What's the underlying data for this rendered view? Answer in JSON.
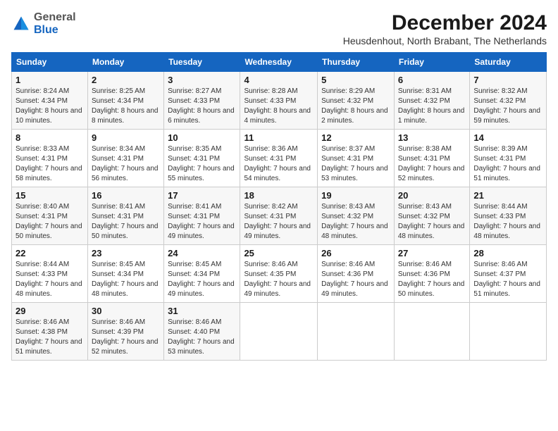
{
  "header": {
    "logo_general": "General",
    "logo_blue": "Blue",
    "title": "December 2024",
    "subtitle": "Heusdenhout, North Brabant, The Netherlands"
  },
  "calendar": {
    "days": [
      "Sunday",
      "Monday",
      "Tuesday",
      "Wednesday",
      "Thursday",
      "Friday",
      "Saturday"
    ],
    "weeks": [
      [
        {
          "day": "1",
          "sunrise": "Sunrise: 8:24 AM",
          "sunset": "Sunset: 4:34 PM",
          "daylight": "Daylight: 8 hours and 10 minutes."
        },
        {
          "day": "2",
          "sunrise": "Sunrise: 8:25 AM",
          "sunset": "Sunset: 4:34 PM",
          "daylight": "Daylight: 8 hours and 8 minutes."
        },
        {
          "day": "3",
          "sunrise": "Sunrise: 8:27 AM",
          "sunset": "Sunset: 4:33 PM",
          "daylight": "Daylight: 8 hours and 6 minutes."
        },
        {
          "day": "4",
          "sunrise": "Sunrise: 8:28 AM",
          "sunset": "Sunset: 4:33 PM",
          "daylight": "Daylight: 8 hours and 4 minutes."
        },
        {
          "day": "5",
          "sunrise": "Sunrise: 8:29 AM",
          "sunset": "Sunset: 4:32 PM",
          "daylight": "Daylight: 8 hours and 2 minutes."
        },
        {
          "day": "6",
          "sunrise": "Sunrise: 8:31 AM",
          "sunset": "Sunset: 4:32 PM",
          "daylight": "Daylight: 8 hours and 1 minute."
        },
        {
          "day": "7",
          "sunrise": "Sunrise: 8:32 AM",
          "sunset": "Sunset: 4:32 PM",
          "daylight": "Daylight: 7 hours and 59 minutes."
        }
      ],
      [
        {
          "day": "8",
          "sunrise": "Sunrise: 8:33 AM",
          "sunset": "Sunset: 4:31 PM",
          "daylight": "Daylight: 7 hours and 58 minutes."
        },
        {
          "day": "9",
          "sunrise": "Sunrise: 8:34 AM",
          "sunset": "Sunset: 4:31 PM",
          "daylight": "Daylight: 7 hours and 56 minutes."
        },
        {
          "day": "10",
          "sunrise": "Sunrise: 8:35 AM",
          "sunset": "Sunset: 4:31 PM",
          "daylight": "Daylight: 7 hours and 55 minutes."
        },
        {
          "day": "11",
          "sunrise": "Sunrise: 8:36 AM",
          "sunset": "Sunset: 4:31 PM",
          "daylight": "Daylight: 7 hours and 54 minutes."
        },
        {
          "day": "12",
          "sunrise": "Sunrise: 8:37 AM",
          "sunset": "Sunset: 4:31 PM",
          "daylight": "Daylight: 7 hours and 53 minutes."
        },
        {
          "day": "13",
          "sunrise": "Sunrise: 8:38 AM",
          "sunset": "Sunset: 4:31 PM",
          "daylight": "Daylight: 7 hours and 52 minutes."
        },
        {
          "day": "14",
          "sunrise": "Sunrise: 8:39 AM",
          "sunset": "Sunset: 4:31 PM",
          "daylight": "Daylight: 7 hours and 51 minutes."
        }
      ],
      [
        {
          "day": "15",
          "sunrise": "Sunrise: 8:40 AM",
          "sunset": "Sunset: 4:31 PM",
          "daylight": "Daylight: 7 hours and 50 minutes."
        },
        {
          "day": "16",
          "sunrise": "Sunrise: 8:41 AM",
          "sunset": "Sunset: 4:31 PM",
          "daylight": "Daylight: 7 hours and 50 minutes."
        },
        {
          "day": "17",
          "sunrise": "Sunrise: 8:41 AM",
          "sunset": "Sunset: 4:31 PM",
          "daylight": "Daylight: 7 hours and 49 minutes."
        },
        {
          "day": "18",
          "sunrise": "Sunrise: 8:42 AM",
          "sunset": "Sunset: 4:31 PM",
          "daylight": "Daylight: 7 hours and 49 minutes."
        },
        {
          "day": "19",
          "sunrise": "Sunrise: 8:43 AM",
          "sunset": "Sunset: 4:32 PM",
          "daylight": "Daylight: 7 hours and 48 minutes."
        },
        {
          "day": "20",
          "sunrise": "Sunrise: 8:43 AM",
          "sunset": "Sunset: 4:32 PM",
          "daylight": "Daylight: 7 hours and 48 minutes."
        },
        {
          "day": "21",
          "sunrise": "Sunrise: 8:44 AM",
          "sunset": "Sunset: 4:33 PM",
          "daylight": "Daylight: 7 hours and 48 minutes."
        }
      ],
      [
        {
          "day": "22",
          "sunrise": "Sunrise: 8:44 AM",
          "sunset": "Sunset: 4:33 PM",
          "daylight": "Daylight: 7 hours and 48 minutes."
        },
        {
          "day": "23",
          "sunrise": "Sunrise: 8:45 AM",
          "sunset": "Sunset: 4:34 PM",
          "daylight": "Daylight: 7 hours and 48 minutes."
        },
        {
          "day": "24",
          "sunrise": "Sunrise: 8:45 AM",
          "sunset": "Sunset: 4:34 PM",
          "daylight": "Daylight: 7 hours and 49 minutes."
        },
        {
          "day": "25",
          "sunrise": "Sunrise: 8:46 AM",
          "sunset": "Sunset: 4:35 PM",
          "daylight": "Daylight: 7 hours and 49 minutes."
        },
        {
          "day": "26",
          "sunrise": "Sunrise: 8:46 AM",
          "sunset": "Sunset: 4:36 PM",
          "daylight": "Daylight: 7 hours and 49 minutes."
        },
        {
          "day": "27",
          "sunrise": "Sunrise: 8:46 AM",
          "sunset": "Sunset: 4:36 PM",
          "daylight": "Daylight: 7 hours and 50 minutes."
        },
        {
          "day": "28",
          "sunrise": "Sunrise: 8:46 AM",
          "sunset": "Sunset: 4:37 PM",
          "daylight": "Daylight: 7 hours and 51 minutes."
        }
      ],
      [
        {
          "day": "29",
          "sunrise": "Sunrise: 8:46 AM",
          "sunset": "Sunset: 4:38 PM",
          "daylight": "Daylight: 7 hours and 51 minutes."
        },
        {
          "day": "30",
          "sunrise": "Sunrise: 8:46 AM",
          "sunset": "Sunset: 4:39 PM",
          "daylight": "Daylight: 7 hours and 52 minutes."
        },
        {
          "day": "31",
          "sunrise": "Sunrise: 8:46 AM",
          "sunset": "Sunset: 4:40 PM",
          "daylight": "Daylight: 7 hours and 53 minutes."
        },
        null,
        null,
        null,
        null
      ]
    ]
  }
}
